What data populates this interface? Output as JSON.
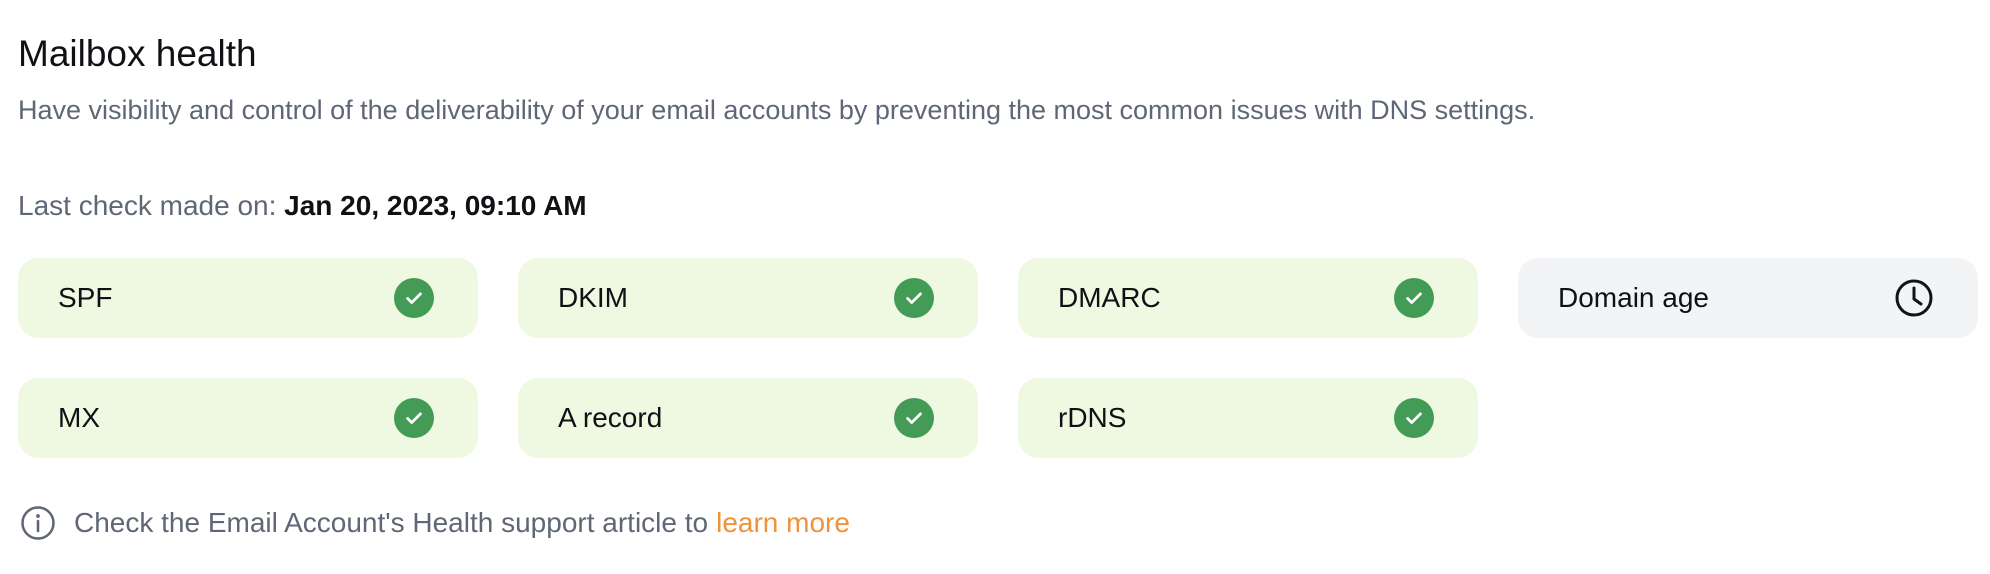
{
  "header": {
    "title": "Mailbox health",
    "subtitle": "Have visibility and control of the deliverability of your email accounts by preventing the most common issues with DNS settings."
  },
  "last_check": {
    "label": "Last check made on:",
    "value": "Jan 20, 2023, 09:10 AM"
  },
  "checks": [
    {
      "label": "SPF",
      "status": "pass",
      "icon": "check-circle-icon"
    },
    {
      "label": "DKIM",
      "status": "pass",
      "icon": "check-circle-icon"
    },
    {
      "label": "DMARC",
      "status": "pass",
      "icon": "check-circle-icon"
    },
    {
      "label": "Domain age",
      "status": "pending",
      "icon": "clock-icon"
    },
    {
      "label": "MX",
      "status": "pass",
      "icon": "check-circle-icon"
    },
    {
      "label": "A record",
      "status": "pass",
      "icon": "check-circle-icon"
    },
    {
      "label": "rDNS",
      "status": "pass",
      "icon": "check-circle-icon"
    }
  ],
  "footer": {
    "icon": "info-icon",
    "text": "Check the Email Account's Health support article to",
    "link_label": "learn more"
  },
  "colors": {
    "pass_background": "#eff9e2",
    "pending_background": "#f3f4f6",
    "check_green": "#439b55",
    "link_orange": "#f0923a",
    "muted_text": "#5f6776"
  }
}
